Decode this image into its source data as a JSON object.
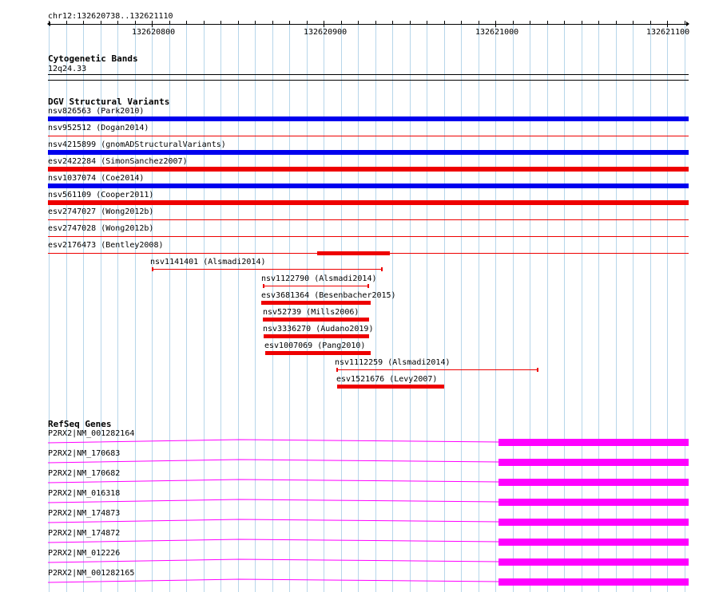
{
  "ruler": {
    "region": "chr12:132620738..132621110",
    "ticks": [
      "132620800",
      "132620900",
      "132621000",
      "132621100"
    ]
  },
  "tracks": {
    "cytoband": {
      "title": "Cytogenetic Bands",
      "band": "12q24.33"
    },
    "dgv": {
      "title": "DGV Structural Variants",
      "features": [
        {
          "label": "nsv826563 (Park2010)",
          "color": "#0000ee",
          "style": "full"
        },
        {
          "label": "nsv952512 (Dogan2014)",
          "color": "#ee0000",
          "style": "thin"
        },
        {
          "label": "nsv4215899 (gnomADStructuralVariants)",
          "color": "#0000ee",
          "style": "full"
        },
        {
          "label": "esv2422284 (SimonSanchez2007)",
          "color": "#ee0000",
          "style": "full"
        },
        {
          "label": "nsv1037074 (Coe2014)",
          "color": "#0000ee",
          "style": "full"
        },
        {
          "label": "nsv561109 (Cooper2011)",
          "color": "#ee0000",
          "style": "full"
        },
        {
          "label": "esv2747027 (Wong2012b)",
          "color": "#ee0000",
          "style": "thin"
        },
        {
          "label": "esv2747028 (Wong2012b)",
          "color": "#ee0000",
          "style": "thin"
        },
        {
          "label": "esv2176473 (Bentley2008)",
          "color": "#ee0000",
          "style": "thin"
        },
        {
          "label": "nsv1141401 (Alsmadi2014)",
          "color": "#ee0000",
          "style": "bracket"
        },
        {
          "label": "nsv1122790 (Alsmadi2014)",
          "color": "#ee0000",
          "style": "bracket"
        },
        {
          "label": "esv3681364 (Besenbacher2015)",
          "color": "#ee0000",
          "style": "bar"
        },
        {
          "label": "nsv52739 (Mills2006)",
          "color": "#ee0000",
          "style": "bar"
        },
        {
          "label": "nsv3336270 (Audano2019)",
          "color": "#ee0000",
          "style": "bar"
        },
        {
          "label": "esv1007069 (Pang2010)",
          "color": "#ee0000",
          "style": "bar"
        },
        {
          "label": "nsv1112259 (Alsmadi2014)",
          "color": "#ee0000",
          "style": "bracket"
        },
        {
          "label": "esv1521676 (Levy2007)",
          "color": "#ee0000",
          "style": "bar"
        }
      ]
    },
    "refseq": {
      "title": "RefSeq Genes",
      "color": "#ff00ff",
      "transcripts": [
        {
          "label": "P2RX2|NM_001282164"
        },
        {
          "label": "P2RX2|NM_170683"
        },
        {
          "label": "P2RX2|NM_170682"
        },
        {
          "label": "P2RX2|NM_016318"
        },
        {
          "label": "P2RX2|NM_174873"
        },
        {
          "label": "P2RX2|NM_174872"
        },
        {
          "label": "P2RX2|NM_012226"
        },
        {
          "label": "P2RX2|NM_001282165"
        }
      ]
    }
  }
}
